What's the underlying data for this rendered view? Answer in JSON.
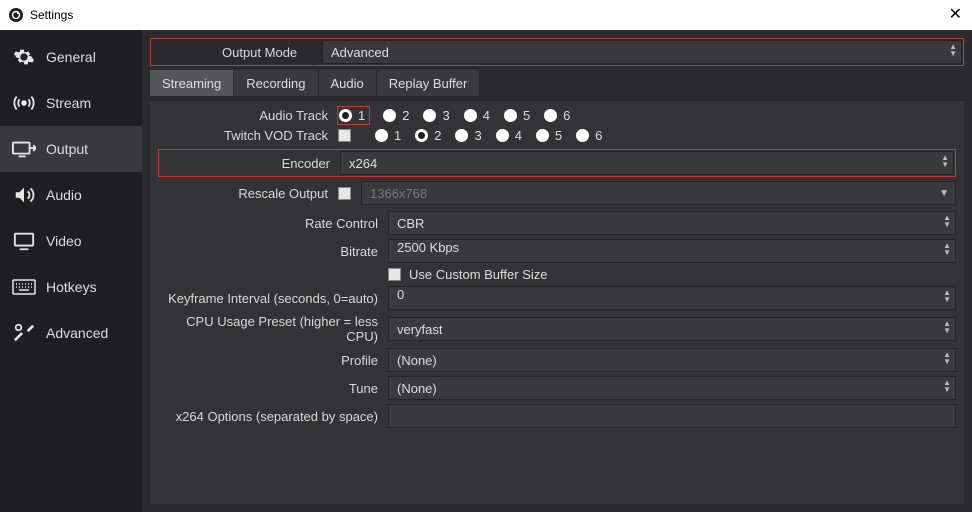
{
  "window": {
    "title": "Settings"
  },
  "sidebar": {
    "items": [
      {
        "label": "General"
      },
      {
        "label": "Stream"
      },
      {
        "label": "Output"
      },
      {
        "label": "Audio"
      },
      {
        "label": "Video"
      },
      {
        "label": "Hotkeys"
      },
      {
        "label": "Advanced"
      }
    ],
    "active_index": 2
  },
  "output_mode": {
    "label": "Output Mode",
    "value": "Advanced"
  },
  "tabs": {
    "items": [
      {
        "label": "Streaming"
      },
      {
        "label": "Recording"
      },
      {
        "label": "Audio"
      },
      {
        "label": "Replay Buffer"
      }
    ],
    "active_index": 0
  },
  "streaming": {
    "audio_track": {
      "label": "Audio Track",
      "options": [
        "1",
        "2",
        "3",
        "4",
        "5",
        "6"
      ],
      "selected": "1"
    },
    "vod_track": {
      "label": "Twitch VOD Track",
      "enabled": false,
      "options": [
        "1",
        "2",
        "3",
        "4",
        "5",
        "6"
      ],
      "selected": "2"
    },
    "encoder": {
      "label": "Encoder",
      "value": "x264"
    },
    "rescale": {
      "label": "Rescale Output",
      "enabled": false,
      "value": "1366x768"
    },
    "rate_control": {
      "label": "Rate Control",
      "value": "CBR"
    },
    "bitrate": {
      "label": "Bitrate",
      "value": "2500 Kbps"
    },
    "custom_buffer": {
      "label": "Use Custom Buffer Size",
      "enabled": false
    },
    "keyframe": {
      "label": "Keyframe Interval (seconds, 0=auto)",
      "value": "0"
    },
    "cpu_preset": {
      "label": "CPU Usage Preset (higher = less CPU)",
      "value": "veryfast"
    },
    "profile": {
      "label": "Profile",
      "value": "(None)"
    },
    "tune": {
      "label": "Tune",
      "value": "(None)"
    },
    "x264_opts": {
      "label": "x264 Options (separated by space)",
      "value": ""
    }
  }
}
